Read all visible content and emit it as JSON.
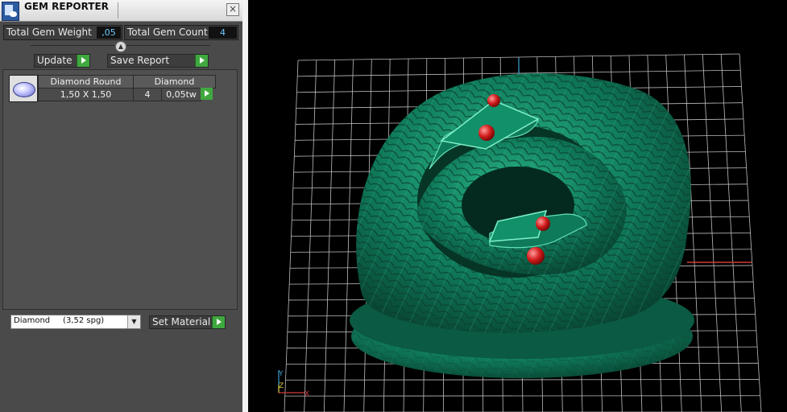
{
  "window": {
    "title": "GEM REPORTER",
    "close_icon": "close-icon"
  },
  "stats": {
    "total_weight_label": "Total Gem Weight",
    "total_weight_value": ",05",
    "total_count_label": "Total Gem Count",
    "total_count_value": "4"
  },
  "actions": {
    "update_label": "Update",
    "save_report_label": "Save Report"
  },
  "gem_list": {
    "items": [
      {
        "shape": "Diamond Round",
        "size": "1,50 X 1,50",
        "material": "Diamond",
        "count": "4",
        "weight": "0,05tw"
      }
    ]
  },
  "material": {
    "selected": "Diamond     (3,52 spg)",
    "set_label": "Set Material"
  },
  "viewport": {
    "axis_labels": {
      "y": "Y",
      "z": "Z",
      "x": "X"
    },
    "colors": {
      "model": "#0f7a5a",
      "gem": "#d21c1c",
      "grid": "#bdbdbd",
      "x_axis": "#d23a3a",
      "y_axis": "#3a9fd2"
    }
  }
}
